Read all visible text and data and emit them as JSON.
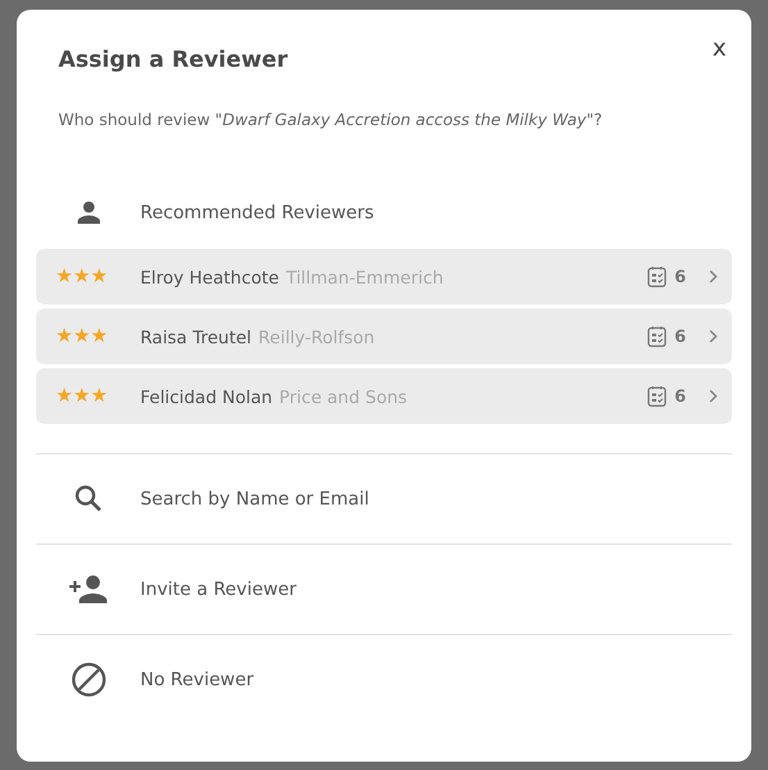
{
  "dialog": {
    "title": "Assign a Reviewer",
    "close": "x",
    "question": "Who should review *\"Dwarf Galaxy Accretion accoss the Milky Way\"*?",
    "recommended": {
      "label": "Recommended Reviewers",
      "reviewers": [
        {
          "stars": 3,
          "name": "Elroy Heathcote",
          "company": "Tillman-Emmerich",
          "count": "6"
        },
        {
          "stars": 3,
          "name": "Raisa Treutel",
          "company": "Reilly-Rolfson",
          "count": "6"
        },
        {
          "stars": 3,
          "name": "Felicidad Nolan",
          "company": "Price and Sons",
          "count": "6"
        }
      ]
    },
    "options": [
      {
        "kind": "search",
        "label": "Search by Name or Email"
      },
      {
        "kind": "invite",
        "label": "Invite a Reviewer"
      },
      {
        "kind": "none",
        "label": "No Reviewer"
      }
    ]
  }
}
